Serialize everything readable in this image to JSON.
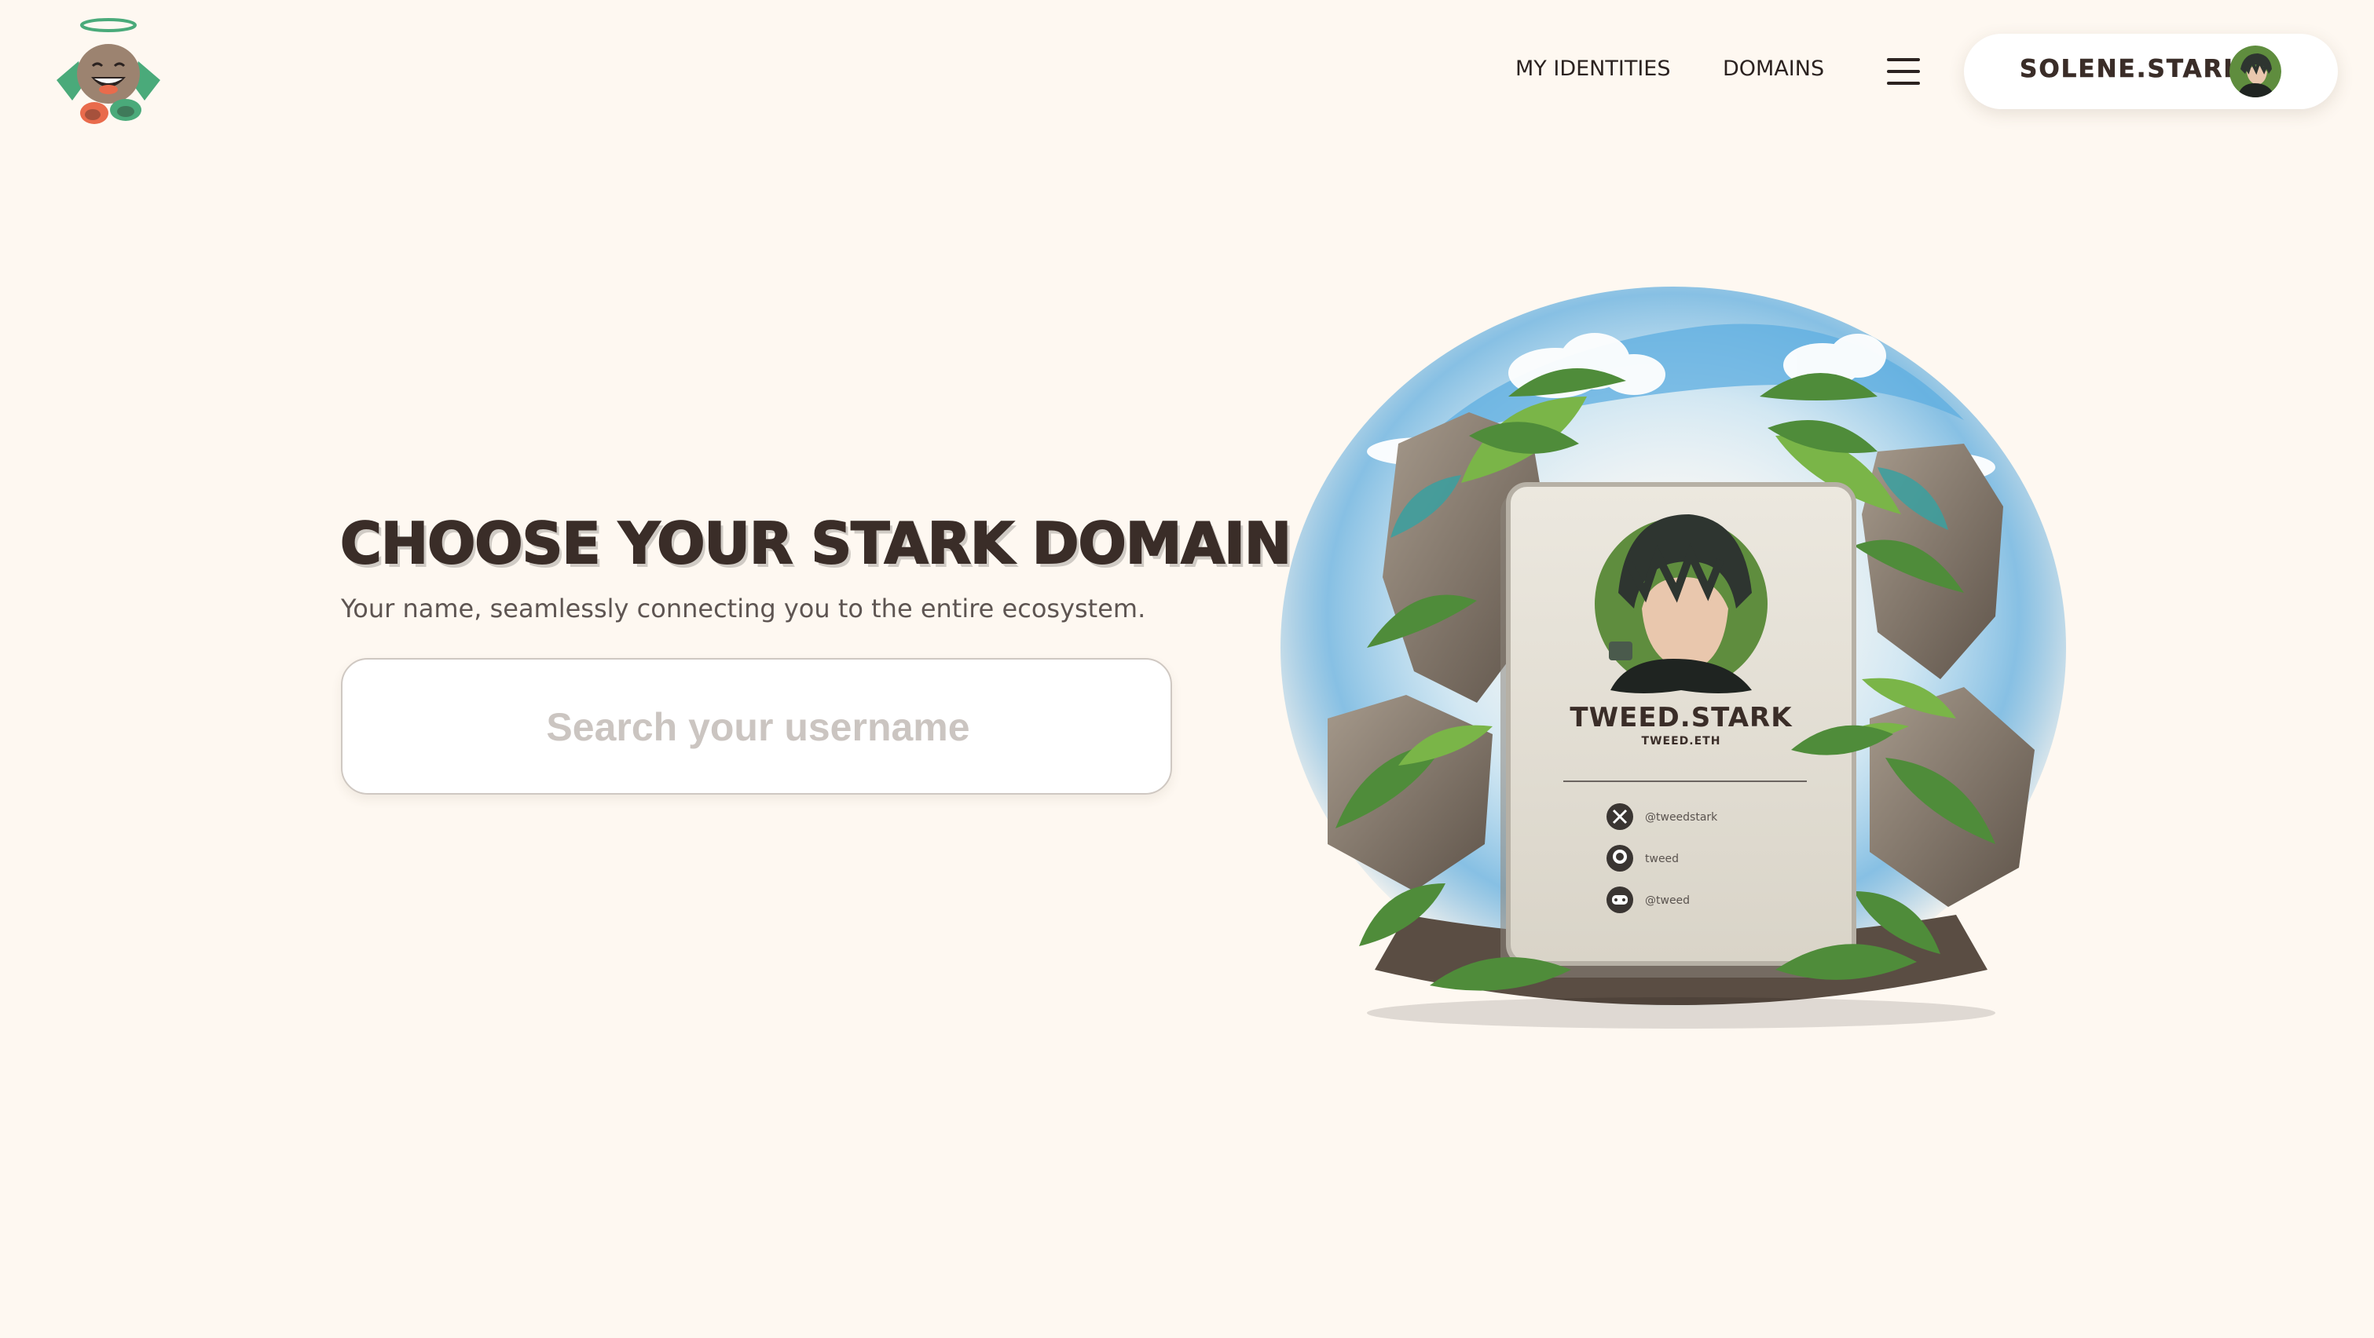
{
  "header": {
    "nav": {
      "my_identities": "MY IDENTITIES",
      "domains": "DOMAINS"
    },
    "wallet": {
      "label": "SOLENE.STARK"
    },
    "icons": {
      "logo": "angel-mascot-logo-icon",
      "menu": "hamburger-menu-icon",
      "avatar": "user-avatar-icon"
    }
  },
  "hero": {
    "title": "CHOOSE YOUR STARK DOMAIN",
    "subtitle": "Your name, seamlessly connecting you to the entire ecosystem.",
    "search": {
      "placeholder": "Search your username",
      "value": ""
    }
  },
  "illustration": {
    "card": {
      "name": "TWEED.STARK",
      "subname": "TWEED.ETH",
      "socials": [
        {
          "icon": "x-icon",
          "handle": "@tweedstark"
        },
        {
          "icon": "github-icon",
          "handle": "tweed"
        },
        {
          "icon": "discord-icon",
          "handle": "@tweed"
        }
      ]
    }
  },
  "colors": {
    "background": "#fef8f1",
    "text_dark": "#3a2d28",
    "subtitle": "#5e5552",
    "placeholder": "#cbc5c1",
    "card_green": "#5f8d3e"
  }
}
